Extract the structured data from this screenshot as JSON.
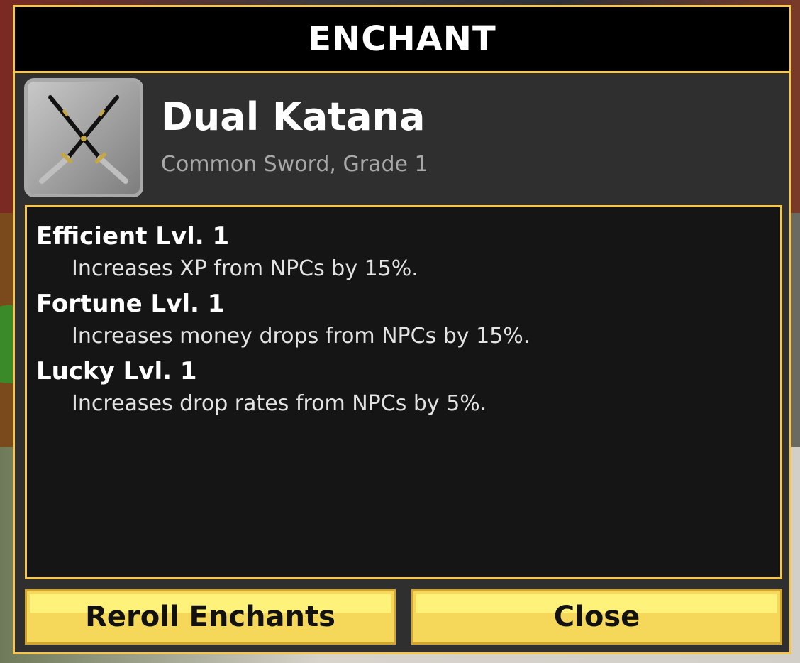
{
  "window": {
    "title": "ENCHANT"
  },
  "item": {
    "name": "Dual Katana",
    "subtitle": "Common Sword, Grade 1",
    "icon": "crossed-katanas-icon"
  },
  "enchants": [
    {
      "name": "Efficient Lvl. 1",
      "description": "Increases XP from NPCs by 15%."
    },
    {
      "name": "Fortune Lvl. 1",
      "description": "Increases money drops from NPCs by 15%."
    },
    {
      "name": "Lucky Lvl. 1",
      "description": "Increases drop rates from NPCs by 5%."
    }
  ],
  "buttons": {
    "reroll_label": "Reroll Enchants",
    "close_label": "Close"
  },
  "colors": {
    "accent_border": "#f5c64a",
    "button_fill": "#f5d85a"
  }
}
